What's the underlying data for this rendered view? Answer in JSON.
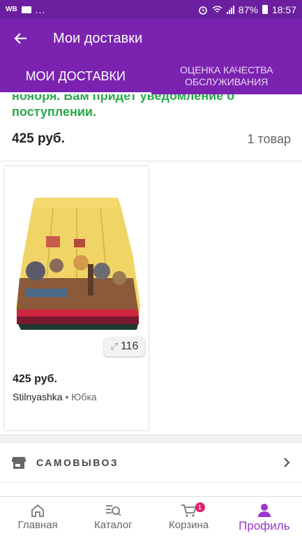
{
  "status_bar": {
    "carrier_icon": "wb-icon",
    "battery_percent": "87%",
    "time": "18:57",
    "dots": "..."
  },
  "app_bar": {
    "title": "Мои доставки",
    "back_icon": "arrow-left-icon"
  },
  "tabs": [
    {
      "label": "МОИ ДОСТАВКИ",
      "active": true
    },
    {
      "label": "ОЦЕНКА КАЧЕСТВА ОБСЛУЖИВАНИЯ",
      "active": false
    }
  ],
  "delivery": {
    "notice": "нояоря. Вам придет уведомление о поступлении.",
    "total_price": "425 руб.",
    "items_count": "1 товар"
  },
  "products": [
    {
      "price": "425 руб.",
      "brand": "Stilnyashka",
      "separator": "•",
      "category": "Юбка",
      "zoom_count": "116",
      "zoom_icon": "expand-icon",
      "image": "skirt-with-cats-print"
    }
  ],
  "pickup": {
    "label": "САМОВЫВОЗ",
    "icon": "store-icon"
  },
  "bottom_nav": [
    {
      "label": "Главная",
      "icon": "home-icon",
      "active": false
    },
    {
      "label": "Каталог",
      "icon": "catalog-search-icon",
      "active": false
    },
    {
      "label": "Корзина",
      "icon": "cart-icon",
      "active": false,
      "badge": "1"
    },
    {
      "label": "Профиль",
      "icon": "profile-icon",
      "active": true
    }
  ],
  "colors": {
    "status_bar": "#6b1e9e",
    "brand_purple": "#7b23b0",
    "notice_green": "#2aa84a",
    "active_nav": "#9b35d0",
    "badge_pink": "#e0216f"
  }
}
